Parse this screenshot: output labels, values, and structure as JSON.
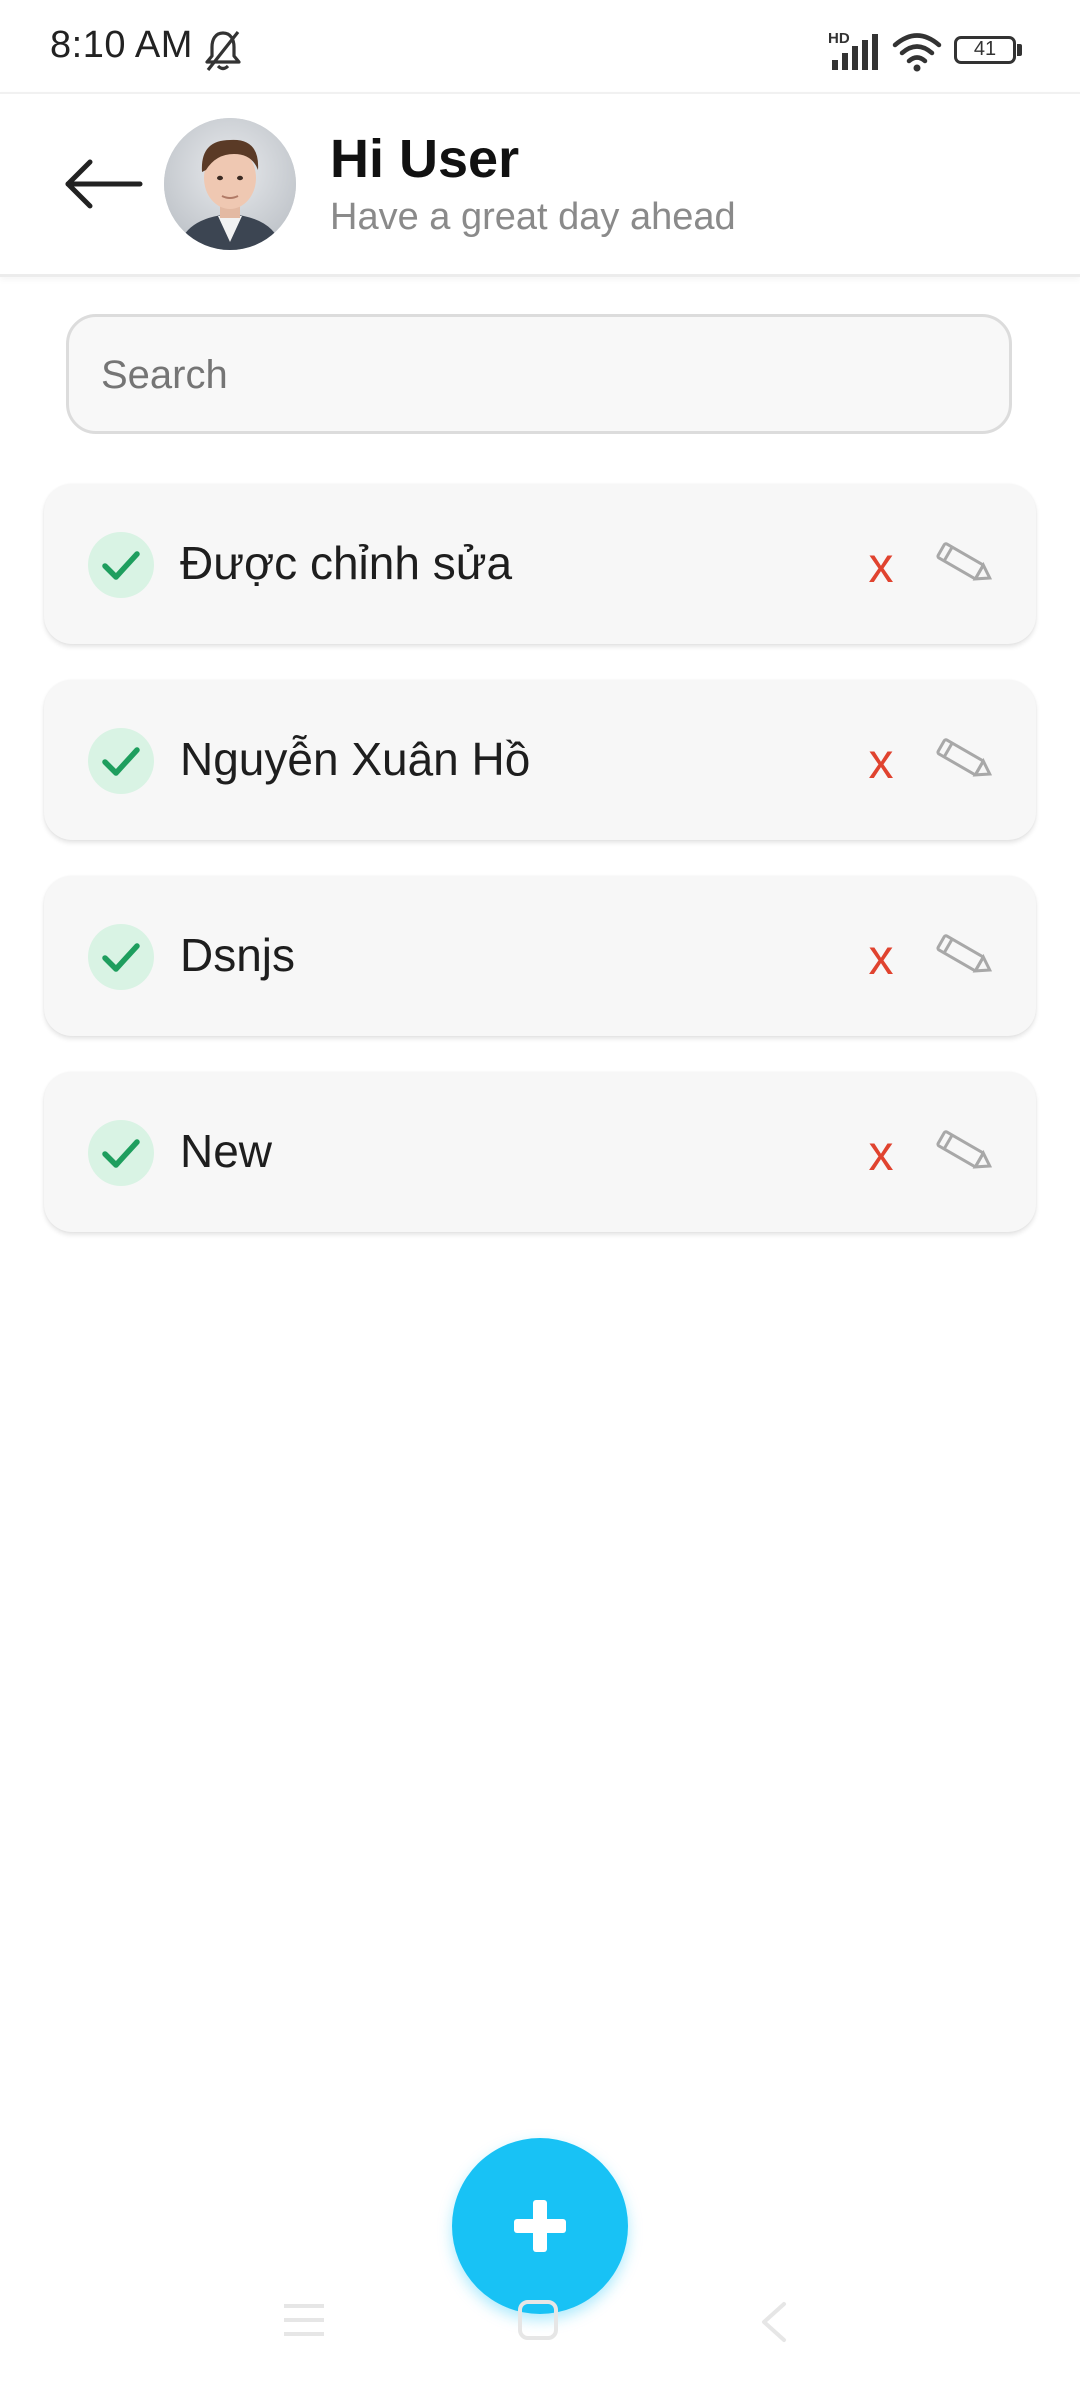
{
  "status_bar": {
    "time": "8:10 AM",
    "battery": "41",
    "network_label": "HD",
    "icons": [
      "bell-muted-icon",
      "signal-icon",
      "wifi-icon",
      "battery-icon"
    ]
  },
  "header": {
    "title": "Hi User",
    "subtitle": "Have a great day ahead",
    "back_icon": "arrow-left-icon",
    "avatar_icon": "avatar"
  },
  "search": {
    "placeholder": "Search",
    "value": ""
  },
  "tasks": [
    {
      "label": "Được chỉnh sửa",
      "done": true,
      "delete_label": "x"
    },
    {
      "label": "Nguyễn Xuân Hồ",
      "done": true,
      "delete_label": "x"
    },
    {
      "label": "Dsnjs",
      "done": true,
      "delete_label": "x"
    },
    {
      "label": "New",
      "done": true,
      "delete_label": "x"
    }
  ],
  "fab": {
    "icon": "plus-icon"
  },
  "colors": {
    "accent": "#18c2f5",
    "check": "#1e9e5e",
    "check_bg": "#d9f3e4",
    "delete": "#e0432f",
    "edit": "#a8a8a8"
  }
}
